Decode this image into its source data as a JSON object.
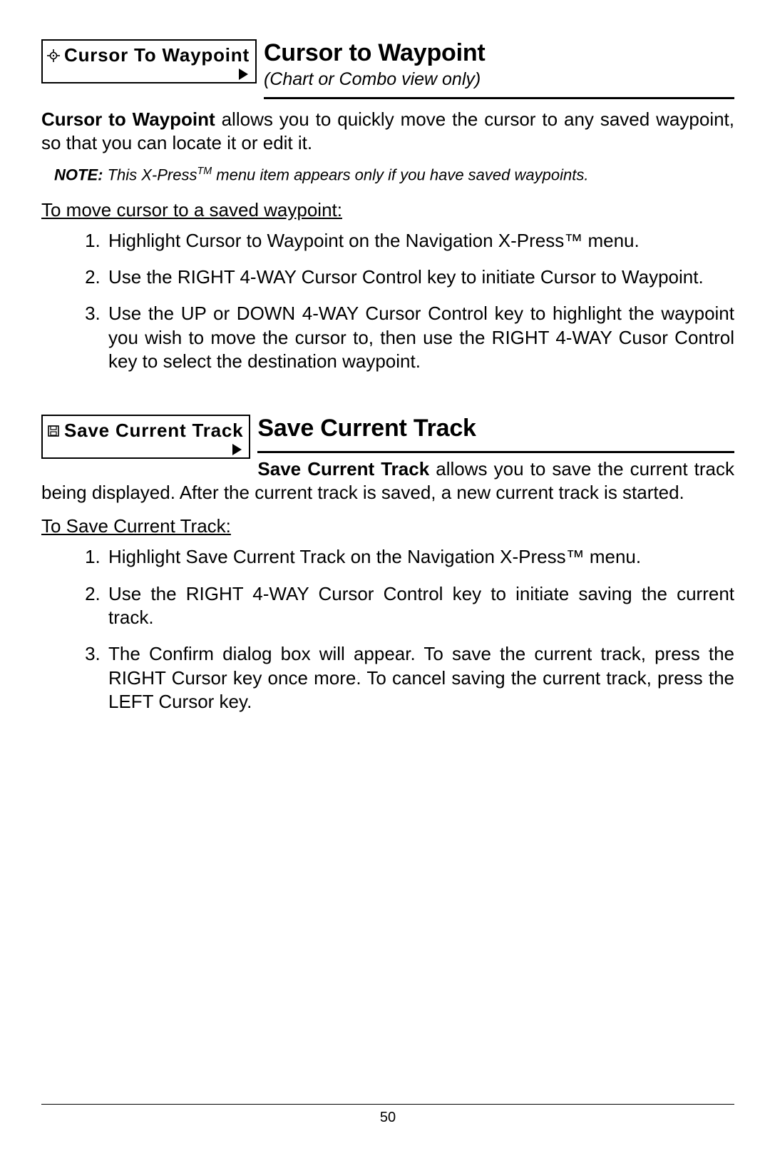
{
  "section1": {
    "uibox_label": "Cursor To Waypoint",
    "title": "Cursor to Waypoint",
    "subtitle": "(Chart or Combo view only)",
    "lead_bold": "Cursor to Waypoint",
    "lead_rest": " allows you to quickly move the cursor to any saved waypoint, so that you can locate it or edit it.",
    "note_label": "NOTE:",
    "note_text_a": "  This X-Press",
    "note_tm": "TM",
    "note_text_b": " menu item appears only if you have saved waypoints.",
    "proc_head": "To move cursor to a saved waypoint:",
    "steps": [
      "Highlight Cursor to Waypoint on the Navigation X-Press™ menu.",
      "Use the RIGHT 4-WAY Cursor Control key to initiate Cursor to Waypoint.",
      "Use the UP or DOWN 4-WAY Cursor Control key to highlight the waypoint you wish to move the cursor to, then use the RIGHT 4-WAY Cusor Control key to select the destination waypoint."
    ]
  },
  "section2": {
    "uibox_label": "Save Current Track",
    "title": "Save Current Track",
    "lead_bold": "Save Current Track",
    "lead_rest": " allows you to save the current track being displayed. After the current track is saved, a new current track is started.",
    "proc_head": "To Save Current Track:",
    "steps": [
      "Highlight Save Current Track on the Navigation X-Press™ menu.",
      "Use the RIGHT 4-WAY Cursor Control key to initiate saving the current track.",
      "The Confirm dialog box will appear. To save the current track,  press the RIGHT Cursor key once more. To cancel saving the current track, press the LEFT Cursor key."
    ]
  },
  "page_number": "50"
}
